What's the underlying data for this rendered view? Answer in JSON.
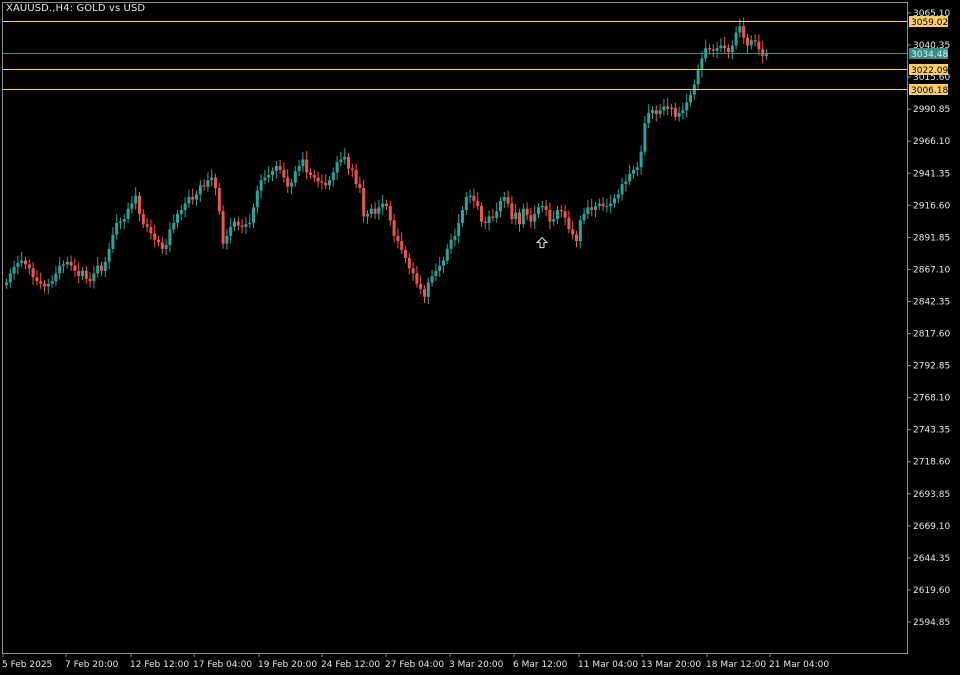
{
  "window": {
    "title": "XAUUSD.,H4:  GOLD vs USD"
  },
  "colors": {
    "background": "#000000",
    "bull": "#26a69a",
    "bear": "#ef5350",
    "level_line": "#ffcc66",
    "bid_line": "#3a8d87",
    "axis_text": "#e6e6e6"
  },
  "price_levels": [
    {
      "price": 3059.02,
      "label": "3059.02",
      "kind": "level"
    },
    {
      "price": 3034.48,
      "label": "3034.48",
      "kind": "bid"
    },
    {
      "price": 3022.09,
      "label": "3022.09",
      "kind": "level"
    },
    {
      "price": 3006.18,
      "label": "3006.18",
      "kind": "level"
    }
  ],
  "chart_data": {
    "type": "candlestick",
    "title": "XAUUSD.,H4:  GOLD vs USD",
    "ylim": [
      2570,
      3069
    ],
    "y_ticks": [
      "3065.10",
      "3040.35",
      "3015.60",
      "2990.85",
      "2966.10",
      "2941.35",
      "2916.60",
      "2891.85",
      "2867.10",
      "2842.35",
      "2817.60",
      "2792.85",
      "2768.10",
      "2743.35",
      "2718.60",
      "2693.85",
      "2669.10",
      "2644.35",
      "2619.60",
      "2594.85"
    ],
    "x_ticks": [
      "5 Feb 2025",
      "7 Feb 20:00",
      "12 Feb 12:00",
      "17 Feb 04:00",
      "19 Feb 20:00",
      "24 Feb 12:00",
      "27 Feb 04:00",
      "3 Mar 20:00",
      "6 Mar 12:00",
      "11 Mar 04:00",
      "13 Mar 20:00",
      "18 Mar 12:00",
      "21 Mar 04:00"
    ],
    "arrow_marker": {
      "label": "up-arrow-marker",
      "price": 2904
    },
    "candles_close": [
      2857,
      2864,
      2869,
      2872,
      2874,
      2871,
      2868,
      2861,
      2858,
      2856,
      2854,
      2856,
      2858,
      2864,
      2870,
      2871,
      2873,
      2870,
      2866,
      2862,
      2866,
      2860,
      2858,
      2864,
      2870,
      2866,
      2873,
      2883,
      2894,
      2903,
      2904,
      2906,
      2914,
      2918,
      2924,
      2910,
      2902,
      2900,
      2895,
      2890,
      2888,
      2883,
      2886,
      2898,
      2903,
      2910,
      2913,
      2918,
      2923,
      2921,
      2925,
      2932,
      2931,
      2936,
      2938,
      2930,
      2912,
      2887,
      2893,
      2900,
      2904,
      2901,
      2900,
      2902,
      2903,
      2915,
      2928,
      2936,
      2938,
      2940,
      2943,
      2947,
      2944,
      2938,
      2931,
      2934,
      2943,
      2947,
      2952,
      2942,
      2940,
      2938,
      2935,
      2934,
      2932,
      2936,
      2942,
      2950,
      2952,
      2954,
      2945,
      2944,
      2933,
      2930,
      2908,
      2910,
      2914,
      2910,
      2915,
      2918,
      2916,
      2905,
      2893,
      2889,
      2882,
      2876,
      2868,
      2864,
      2856,
      2852,
      2846,
      2857,
      2862,
      2866,
      2870,
      2874,
      2883,
      2890,
      2893,
      2903,
      2913,
      2923,
      2924,
      2920,
      2916,
      2904,
      2903,
      2908,
      2907,
      2912,
      2920,
      2923,
      2918,
      2906,
      2911,
      2902,
      2914,
      2909,
      2904,
      2910,
      2915,
      2916,
      2913,
      2904,
      2906,
      2913,
      2912,
      2907,
      2898,
      2894,
      2889,
      2905,
      2910,
      2915,
      2913,
      2916,
      2918,
      2916,
      2916,
      2918,
      2922,
      2925,
      2933,
      2935,
      2941,
      2944,
      2946,
      2958,
      2980,
      2988,
      2990,
      2987,
      2990,
      2993,
      2991,
      2992,
      2985,
      2988,
      2990,
      2996,
      3002,
      3010,
      3021,
      3030,
      3038,
      3037,
      3036,
      3038,
      3040,
      3038,
      3035,
      3040,
      3050,
      3055,
      3046,
      3040,
      3044,
      3043,
      3037,
      3032,
      3034
    ]
  },
  "x_ticks_labels": {
    "t0": "5 Feb 2025",
    "t1": "7 Feb 20:00",
    "t2": "12 Feb 12:00",
    "t3": "17 Feb 04:00",
    "t4": "19 Feb 20:00",
    "t5": "24 Feb 12:00",
    "t6": "27 Feb 04:00",
    "t7": "3 Mar 20:00",
    "t8": "6 Mar 12:00",
    "t9": "11 Mar 04:00",
    "t10": "13 Mar 20:00",
    "t11": "18 Mar 12:00",
    "t12": "21 Mar 04:00"
  }
}
